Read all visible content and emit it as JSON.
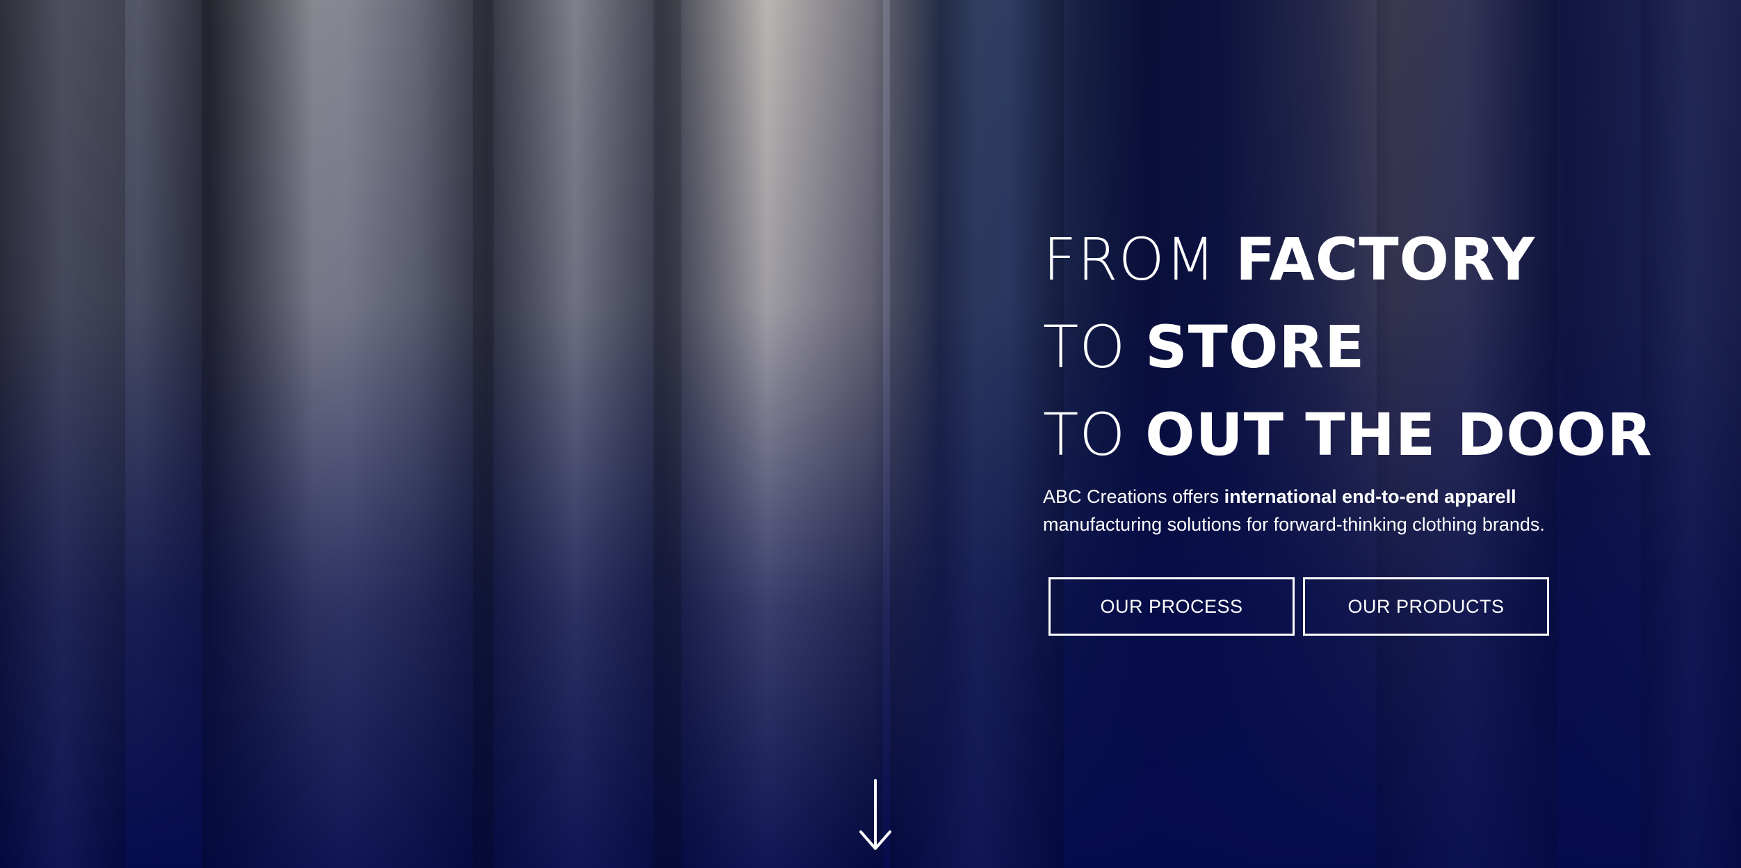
{
  "hero": {
    "headline": [
      {
        "light": "FROM ",
        "bold": "FACTORY"
      },
      {
        "light": "TO ",
        "bold": "STORE"
      },
      {
        "light": "TO ",
        "bold": "OUT THE DOOR"
      }
    ],
    "tagline": {
      "part1": "ABC Creations offers ",
      "bold": "international end-to-end apparell",
      "part2": "manufacturing solutions for forward-thinking clothing brands."
    },
    "buttons": {
      "process_label": "OUR PROCESS",
      "products_label": "OUR PRODUCTS"
    },
    "scroll_icon": "arrow-down-icon",
    "colors": {
      "overlay": "#050c4d",
      "text": "#ffffff"
    }
  }
}
